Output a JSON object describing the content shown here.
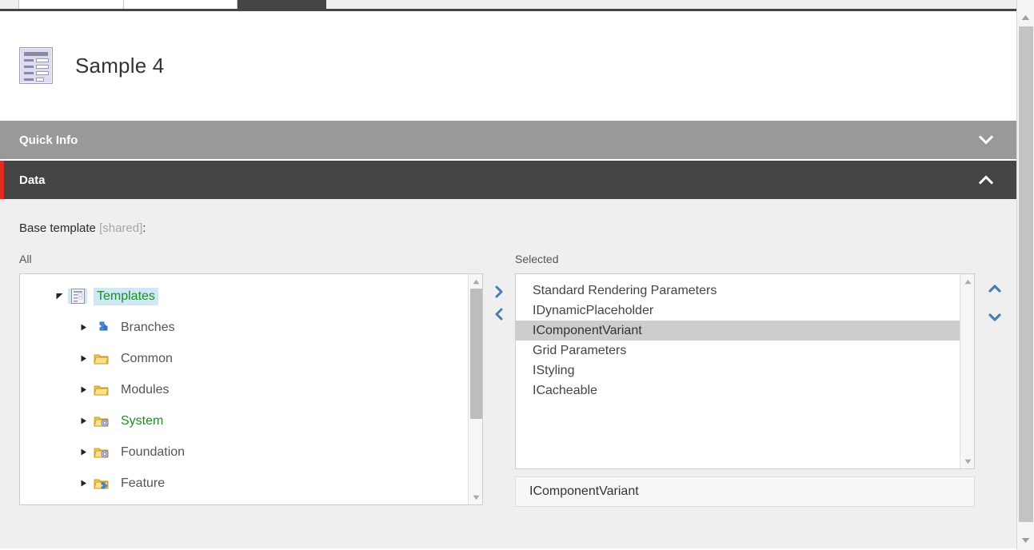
{
  "window": {
    "tabs": [
      {
        "label": "",
        "state": "inactive"
      },
      {
        "label": "",
        "state": "inactive"
      },
      {
        "label": "",
        "state": "active"
      }
    ]
  },
  "header": {
    "title": "Sample 4",
    "icon": "form-document-icon"
  },
  "sections": [
    {
      "id": "quick-info",
      "title": "Quick Info",
      "expanded": false,
      "chevron": "chevron-down-icon",
      "accent": "#999999"
    },
    {
      "id": "data",
      "title": "Data",
      "expanded": true,
      "chevron": "chevron-up-icon",
      "accent": "#444444",
      "marker_color": "#e02b20"
    }
  ],
  "field": {
    "label": "Base template",
    "shared_tag": "[shared]",
    "colon": ":",
    "all_label": "All",
    "selected_label": "Selected"
  },
  "tree": {
    "nodes": [
      {
        "label": "Templates",
        "icon": "template-document-icon",
        "twisty": "collapse-triangle",
        "level": 0,
        "selected": true,
        "green": true
      },
      {
        "label": "Branches",
        "icon": "branch-puzzle-icon",
        "twisty": "expand-triangle",
        "level": 1,
        "selected": false,
        "green": false
      },
      {
        "label": "Common",
        "icon": "folder-icon",
        "twisty": "expand-triangle",
        "level": 1,
        "selected": false,
        "green": false
      },
      {
        "label": "Modules",
        "icon": "folder-icon",
        "twisty": "expand-triangle",
        "level": 1,
        "selected": false,
        "green": false
      },
      {
        "label": "System",
        "icon": "folder-gear-icon",
        "twisty": "expand-triangle",
        "level": 1,
        "selected": false,
        "green": true
      },
      {
        "label": "Foundation",
        "icon": "folder-gear-icon",
        "twisty": "expand-triangle",
        "level": 1,
        "selected": false,
        "green": false
      },
      {
        "label": "Feature",
        "icon": "folder-puzzle-icon",
        "twisty": "expand-triangle",
        "level": 1,
        "selected": false,
        "green": false
      }
    ]
  },
  "transfer_buttons": [
    {
      "id": "add",
      "icon": "chevron-right-icon",
      "color": "#4a7db5"
    },
    {
      "id": "remove",
      "icon": "chevron-left-icon",
      "color": "#4a7db5"
    }
  ],
  "reorder_buttons": [
    {
      "id": "move-up",
      "icon": "chevron-up-icon",
      "color": "#4a7db5"
    },
    {
      "id": "move-down",
      "icon": "chevron-down-icon",
      "color": "#4a7db5"
    }
  ],
  "selected_list": {
    "items": [
      {
        "label": "Standard Rendering Parameters",
        "selected": false
      },
      {
        "label": "IDynamicPlaceholder",
        "selected": false
      },
      {
        "label": "IComponentVariant",
        "selected": true
      },
      {
        "label": "Grid Parameters",
        "selected": false
      },
      {
        "label": "IStyling",
        "selected": false
      },
      {
        "label": "ICacheable",
        "selected": false
      }
    ],
    "footer_value": "IComponentVariant"
  },
  "scrollbars": {
    "tree": {
      "up_icon": "scroll-up-arrow-icon",
      "down_icon": "scroll-down-arrow-icon",
      "thumb_visible": true
    },
    "selected": {
      "up_icon": "scroll-up-arrow-icon",
      "down_icon": "scroll-down-arrow-icon",
      "thumb_visible": false
    },
    "page": {
      "up_icon": "scroll-up-arrow-icon",
      "down_icon": "scroll-down-arrow-icon",
      "thumb_visible": true
    }
  },
  "colors": {
    "quick_info_bar": "#999999",
    "data_bar": "#444444",
    "required_marker": "#e02b20",
    "field_background": "#efefef",
    "tree_selection": "#cfe8f5",
    "list_selection": "#cdcdcd",
    "green_text": "#1f8b24",
    "arrow_blue": "#4a7db5"
  }
}
